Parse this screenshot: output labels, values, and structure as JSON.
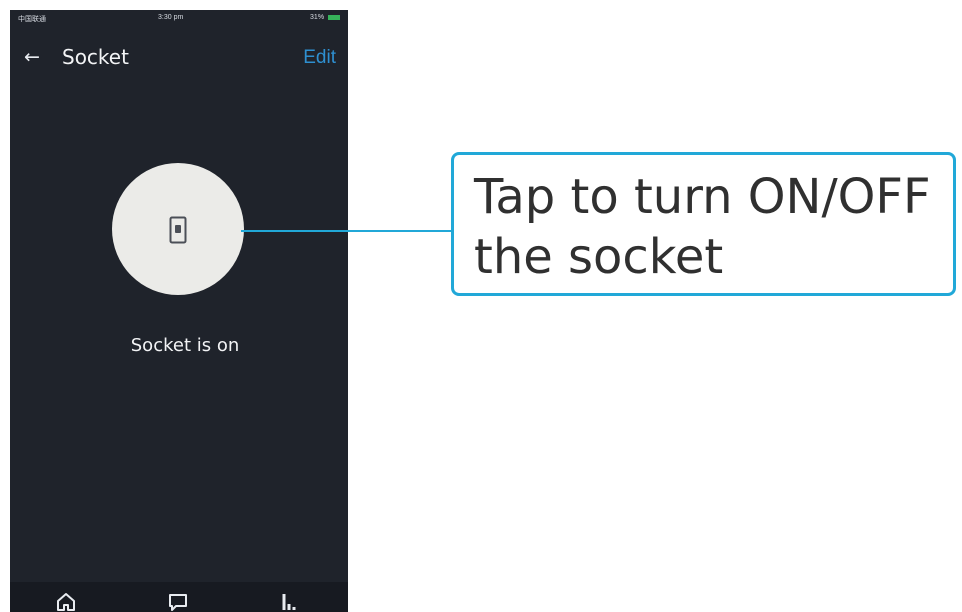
{
  "status_bar": {
    "carrier": "中国联通",
    "time": "3:30 pm",
    "battery": "31%"
  },
  "header": {
    "title": "Socket",
    "edit_label": "Edit"
  },
  "device": {
    "status": "Socket is on",
    "power_icon": "socket-switch-icon"
  },
  "tabbar": {
    "home_icon": "home-icon",
    "message_icon": "message-icon",
    "stats_icon": "stats-icon"
  },
  "callout": {
    "line1": "Tap to turn ON/OFF",
    "line2": "the socket",
    "accent_color": "#21a8d8"
  },
  "colors": {
    "phone_background": "#1f232b",
    "edit_accent": "#2e8fd0"
  }
}
